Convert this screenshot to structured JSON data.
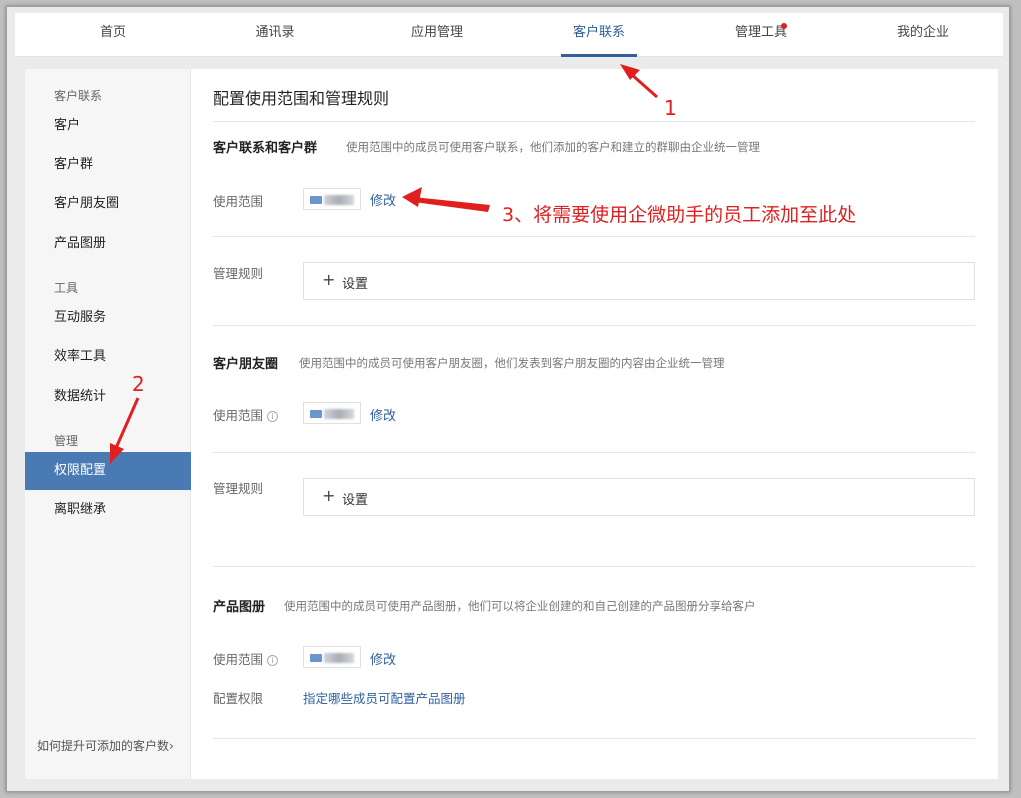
{
  "topnav": {
    "tabs": [
      {
        "label": "首页"
      },
      {
        "label": "通讯录"
      },
      {
        "label": "应用管理"
      },
      {
        "label": "客户联系"
      },
      {
        "label": "管理工具"
      },
      {
        "label": "我的企业"
      }
    ],
    "active_tab": "客户联系",
    "badge_tab": "管理工具"
  },
  "sidebar": {
    "groups": [
      {
        "title": "客户联系",
        "items": [
          "客户",
          "客户群",
          "客户朋友圈",
          "产品图册"
        ]
      },
      {
        "title": "工具",
        "items": [
          "互动服务",
          "效率工具",
          "数据统计"
        ]
      },
      {
        "title": "管理",
        "items": [
          "权限配置",
          "离职继承"
        ]
      }
    ],
    "active_item": "权限配置",
    "footer_link": "如何提升可添加的客户数",
    "footer_chevron": "›"
  },
  "main": {
    "page_title": "配置使用范围和管理规则",
    "sections": [
      {
        "title": "客户联系和客户群",
        "description": "使用范围中的成员可使用客户联系，他们添加的客户和建立的群聊由企业统一管理",
        "scope_label": "使用范围",
        "modify_link": "修改",
        "rule_label": "管理规则",
        "rule_button": "设置"
      },
      {
        "title": "客户朋友圈",
        "description": "使用范围中的成员可使用客户朋友圈，他们发表到客户朋友圈的内容由企业统一管理",
        "scope_label": "使用范围",
        "modify_link": "修改",
        "rule_label": "管理规则",
        "rule_button": "设置"
      },
      {
        "title": "产品图册",
        "description": "使用范围中的成员可使用产品图册，他们可以将企业创建的和自己创建的产品图册分享给客户",
        "scope_label": "使用范围",
        "modify_link": "修改",
        "perm_label": "配置权限",
        "perm_link": "指定哪些成员可配置产品图册"
      }
    ],
    "info_icon_glyph": "i",
    "plus_glyph": "+"
  },
  "annotations": {
    "marker_1": "1",
    "marker_2": "2",
    "note_3": "3、将需要使用企微助手的员工添加至此处",
    "color": "#e02020"
  },
  "colors": {
    "accent": "#2e5f9e",
    "sidebar_active": "#4a7ab4",
    "badge": "#e02020"
  }
}
